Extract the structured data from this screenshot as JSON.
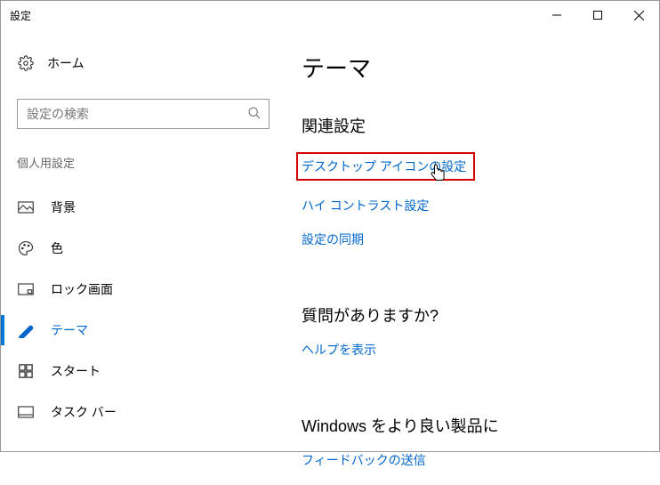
{
  "window": {
    "title": "設定"
  },
  "sidebar": {
    "home": "ホーム",
    "search_placeholder": "設定の検索",
    "group": "個人用設定",
    "items": [
      {
        "label": "背景"
      },
      {
        "label": "色"
      },
      {
        "label": "ロック画面"
      },
      {
        "label": "テーマ"
      },
      {
        "label": "スタート"
      },
      {
        "label": "タスク バー"
      }
    ]
  },
  "content": {
    "title": "テーマ",
    "related": {
      "heading": "関連設定",
      "links": [
        "デスクトップ アイコンの設定",
        "ハイ コントラスト設定",
        "設定の同期"
      ]
    },
    "help": {
      "heading": "質問がありますか?",
      "link": "ヘルプを表示"
    },
    "feedback": {
      "heading": "Windows をより良い製品に",
      "link": "フィードバックの送信"
    }
  }
}
